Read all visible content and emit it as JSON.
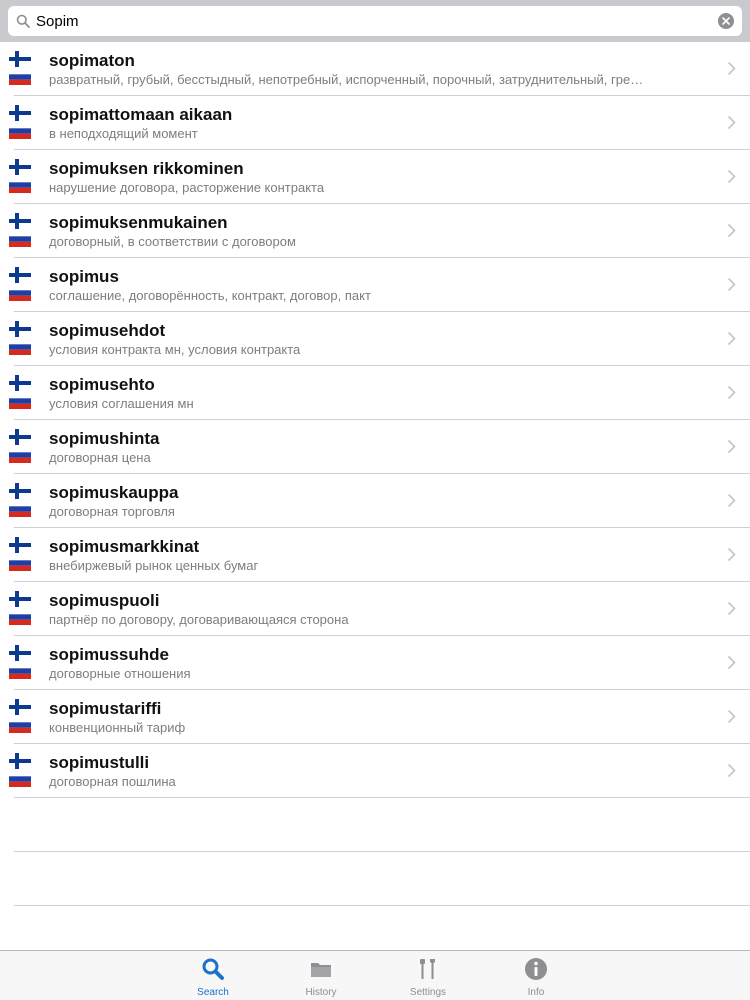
{
  "search": {
    "value": "Sopim",
    "placeholder": ""
  },
  "results": [
    {
      "term": "sopimaton",
      "translation": "развратный, грубый, бесстыдный, непотребный, испорченный, порочный, затруднительный, гре…"
    },
    {
      "term": "sopimattomaan aikaan",
      "translation": "в неподходящий момент"
    },
    {
      "term": "sopimuksen rikkominen",
      "translation": "нарушение договора, расторжение контракта"
    },
    {
      "term": "sopimuksenmukainen",
      "translation": "договорный, в соответствии с договором"
    },
    {
      "term": "sopimus",
      "translation": "соглашение, договорённость, контракт, договор, пакт"
    },
    {
      "term": "sopimusehdot",
      "translation": "условия контракта  мн, условия контракта"
    },
    {
      "term": "sopimusehto",
      "translation": "условия соглашения  мн"
    },
    {
      "term": "sopimushinta",
      "translation": "договорная цена"
    },
    {
      "term": "sopimuskauppa",
      "translation": "договорная торговля"
    },
    {
      "term": "sopimusmarkkinat",
      "translation": "внебиржевый рынок ценных бумаг"
    },
    {
      "term": "sopimuspuoli",
      "translation": "партнёр по договору, договаривающаяся сторона"
    },
    {
      "term": "sopimussuhde",
      "translation": "договорные отношения"
    },
    {
      "term": "sopimustariffi",
      "translation": "конвенционный тариф"
    },
    {
      "term": "sopimustulli",
      "translation": "договорная пошлина"
    }
  ],
  "tabs": {
    "search": "Search",
    "history": "History",
    "settings": "Settings",
    "info": "Info"
  },
  "colors": {
    "accent": "#1a73c8",
    "inactive": "#8e8e93",
    "finland_blue": "#0b3a8f",
    "russia_blue": "#1f3fa8",
    "russia_red": "#d52b1e"
  },
  "icons": {
    "search_tab": "magnifier-icon",
    "history_tab": "folder-icon",
    "settings_tab": "tools-icon",
    "info_tab": "info-circle-icon"
  }
}
